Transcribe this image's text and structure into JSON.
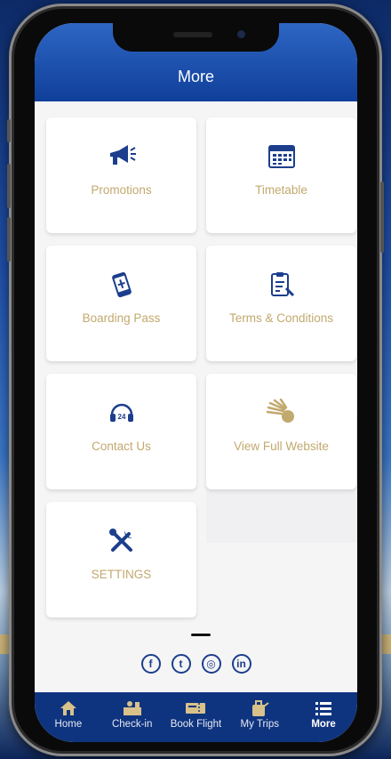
{
  "header": {
    "title": "More"
  },
  "menu": {
    "items": [
      {
        "label": "Promotions",
        "icon": "megaphone-icon"
      },
      {
        "label": "Timetable",
        "icon": "calendar-icon"
      },
      {
        "label": "Boarding Pass",
        "icon": "boarding-pass-icon"
      },
      {
        "label": "Terms & Conditions",
        "icon": "clipboard-icon"
      },
      {
        "label": "Contact Us",
        "icon": "headset-icon"
      },
      {
        "label": "View Full Website",
        "icon": "website-logo-icon"
      },
      {
        "label": "SETTINGS",
        "icon": "tools-icon"
      }
    ]
  },
  "social": {
    "facebook": "f",
    "twitter": "t",
    "instagram": "◎",
    "linkedin": "in"
  },
  "tabbar": {
    "items": [
      {
        "label": "Home",
        "icon": "home-icon"
      },
      {
        "label": "Check-in",
        "icon": "check-in-icon"
      },
      {
        "label": "Book Flight",
        "icon": "ticket-icon"
      },
      {
        "label": "My Trips",
        "icon": "trips-icon"
      },
      {
        "label": "More",
        "icon": "list-icon"
      }
    ],
    "active": "More"
  },
  "colors": {
    "brand_blue": "#0f347f",
    "header_blue": "#2e66c4",
    "label_gold": "#c2a96d",
    "icon_navy": "#1c3e8c"
  }
}
